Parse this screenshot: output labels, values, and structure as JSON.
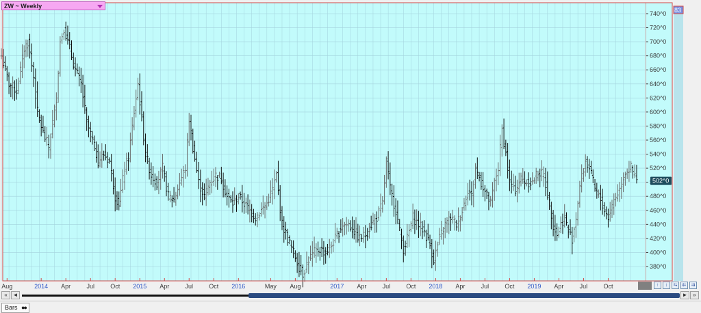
{
  "symbol": {
    "label": "ZW ~ Weekly"
  },
  "last_price_label": "502^0",
  "top_badge": "83",
  "footer": {
    "tab_label": "Bars"
  },
  "nav_buttons": [
    "↑",
    "↕",
    "⇆",
    "⇇",
    "⇉"
  ],
  "scroll": {
    "left_arrow": "◄",
    "right_arrow": "►",
    "end_left": "«",
    "end_right": "»"
  },
  "colors": {
    "plot_bg": "#c2fbfb",
    "grid": "#a3d2dc",
    "bar_dark": "#101010",
    "bar_light": "#6a6a6a",
    "axis_label": "#3a3a3a",
    "year_label": "#2a55c8",
    "frame": "#d04848",
    "price_box": "#1e4d5e"
  },
  "chart_data": {
    "type": "ohlc-bar",
    "title": "",
    "xlabel": "",
    "ylabel": "",
    "ylim": [
      360,
      750
    ],
    "yticks": [
      380,
      400,
      420,
      440,
      460,
      480,
      500,
      520,
      540,
      560,
      580,
      600,
      620,
      640,
      660,
      680,
      700,
      720,
      740
    ],
    "ytick_labels": [
      "380^0",
      "400^0",
      "420^0",
      "440^0",
      "460^0",
      "480^0",
      "500^0",
      "520^0",
      "540^0",
      "560^0",
      "580^0",
      "600^0",
      "620^0",
      "640^0",
      "660^0",
      "680^0",
      "700^0",
      "720^0",
      "740^0"
    ],
    "xtick_labels": [
      {
        "label": "Aug",
        "bar": 3,
        "year": false
      },
      {
        "label": "2014",
        "bar": 21,
        "year": true
      },
      {
        "label": "Apr",
        "bar": 34,
        "year": false
      },
      {
        "label": "Jul",
        "bar": 47,
        "year": false
      },
      {
        "label": "Oct",
        "bar": 60,
        "year": false
      },
      {
        "label": "2015",
        "bar": 73,
        "year": true
      },
      {
        "label": "Apr",
        "bar": 86,
        "year": false
      },
      {
        "label": "Jul",
        "bar": 99,
        "year": false
      },
      {
        "label": "Oct",
        "bar": 112,
        "year": false
      },
      {
        "label": "2016",
        "bar": 125,
        "year": true
      },
      {
        "label": "May",
        "bar": 142,
        "year": false
      },
      {
        "label": "Aug",
        "bar": 155,
        "year": false
      },
      {
        "label": "2017",
        "bar": 177,
        "year": true
      },
      {
        "label": "Apr",
        "bar": 190,
        "year": false
      },
      {
        "label": "Jul",
        "bar": 203,
        "year": false
      },
      {
        "label": "Oct",
        "bar": 216,
        "year": false
      },
      {
        "label": "2018",
        "bar": 229,
        "year": true
      },
      {
        "label": "Apr",
        "bar": 242,
        "year": false
      },
      {
        "label": "Jul",
        "bar": 255,
        "year": false
      },
      {
        "label": "Oct",
        "bar": 268,
        "year": false
      },
      {
        "label": "2019",
        "bar": 281,
        "year": true
      },
      {
        "label": "Apr",
        "bar": 294,
        "year": false
      },
      {
        "label": "Jul",
        "bar": 307,
        "year": false
      },
      {
        "label": "Oct",
        "bar": 320,
        "year": false
      }
    ],
    "close_anchors": [
      [
        0,
        680
      ],
      [
        4,
        640
      ],
      [
        8,
        630
      ],
      [
        12,
        690
      ],
      [
        14,
        700
      ],
      [
        17,
        650
      ],
      [
        19,
        600
      ],
      [
        22,
        570
      ],
      [
        25,
        550
      ],
      [
        29,
        620
      ],
      [
        31,
        700
      ],
      [
        33,
        720
      ],
      [
        36,
        690
      ],
      [
        39,
        660
      ],
      [
        42,
        640
      ],
      [
        45,
        585
      ],
      [
        48,
        560
      ],
      [
        51,
        530
      ],
      [
        54,
        540
      ],
      [
        57,
        530
      ],
      [
        60,
        480
      ],
      [
        62,
        470
      ],
      [
        65,
        520
      ],
      [
        67,
        535
      ],
      [
        70,
        600
      ],
      [
        72,
        640
      ],
      [
        74,
        590
      ],
      [
        76,
        540
      ],
      [
        79,
        510
      ],
      [
        82,
        500
      ],
      [
        85,
        520
      ],
      [
        88,
        480
      ],
      [
        91,
        475
      ],
      [
        94,
        500
      ],
      [
        97,
        520
      ],
      [
        99,
        590
      ],
      [
        101,
        550
      ],
      [
        104,
        500
      ],
      [
        107,
        480
      ],
      [
        110,
        500
      ],
      [
        113,
        510
      ],
      [
        116,
        505
      ],
      [
        119,
        480
      ],
      [
        122,
        470
      ],
      [
        125,
        480
      ],
      [
        128,
        470
      ],
      [
        131,
        460
      ],
      [
        134,
        450
      ],
      [
        137,
        460
      ],
      [
        140,
        470
      ],
      [
        143,
        490
      ],
      [
        145,
        510
      ],
      [
        148,
        440
      ],
      [
        151,
        420
      ],
      [
        154,
        400
      ],
      [
        157,
        380
      ],
      [
        159,
        370
      ],
      [
        162,
        390
      ],
      [
        165,
        400
      ],
      [
        168,
        405
      ],
      [
        171,
        400
      ],
      [
        174,
        410
      ],
      [
        177,
        425
      ],
      [
        180,
        440
      ],
      [
        183,
        440
      ],
      [
        186,
        430
      ],
      [
        189,
        420
      ],
      [
        192,
        425
      ],
      [
        195,
        440
      ],
      [
        198,
        450
      ],
      [
        201,
        470
      ],
      [
        203,
        530
      ],
      [
        205,
        490
      ],
      [
        208,
        460
      ],
      [
        210,
        430
      ],
      [
        212,
        405
      ],
      [
        214,
        420
      ],
      [
        217,
        450
      ],
      [
        220,
        440
      ],
      [
        223,
        430
      ],
      [
        226,
        410
      ],
      [
        228,
        390
      ],
      [
        231,
        420
      ],
      [
        234,
        440
      ],
      [
        237,
        450
      ],
      [
        240,
        440
      ],
      [
        243,
        460
      ],
      [
        246,
        490
      ],
      [
        248,
        480
      ],
      [
        250,
        520
      ],
      [
        253,
        500
      ],
      [
        256,
        480
      ],
      [
        258,
        470
      ],
      [
        260,
        500
      ],
      [
        262,
        520
      ],
      [
        264,
        575
      ],
      [
        266,
        540
      ],
      [
        268,
        500
      ],
      [
        271,
        490
      ],
      [
        274,
        505
      ],
      [
        277,
        500
      ],
      [
        280,
        500
      ],
      [
        283,
        515
      ],
      [
        286,
        510
      ],
      [
        289,
        470
      ],
      [
        291,
        440
      ],
      [
        293,
        425
      ],
      [
        295,
        440
      ],
      [
        297,
        450
      ],
      [
        299,
        430
      ],
      [
        301,
        420
      ],
      [
        303,
        450
      ],
      [
        305,
        495
      ],
      [
        308,
        530
      ],
      [
        310,
        520
      ],
      [
        313,
        490
      ],
      [
        316,
        475
      ],
      [
        318,
        460
      ],
      [
        320,
        450
      ],
      [
        323,
        475
      ],
      [
        326,
        490
      ],
      [
        329,
        515
      ],
      [
        332,
        520
      ],
      [
        335,
        502
      ]
    ],
    "last_price": 502
  }
}
